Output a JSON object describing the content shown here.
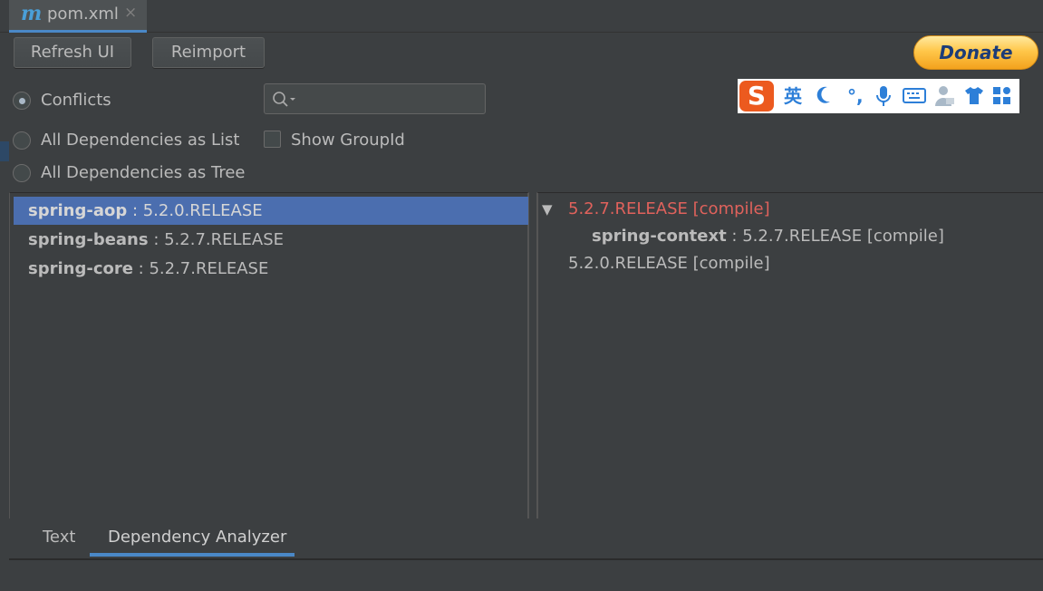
{
  "editor_tab": {
    "label": "pom.xml",
    "icon": "m",
    "close": "×"
  },
  "toolbar": {
    "refresh_label": "Refresh UI",
    "reimport_label": "Reimport"
  },
  "donate": {
    "label": "Donate"
  },
  "ime_toolbar": {
    "logo": "S",
    "mode": "英",
    "icons": [
      "moon-icon",
      "punctuation-icon",
      "microphone-icon",
      "keyboard-icon",
      "user-icon",
      "shirt-icon",
      "grid-icon"
    ]
  },
  "view_options": {
    "conflicts": "Conflicts",
    "list": "All Dependencies as List",
    "tree": "All Dependencies as Tree",
    "selected": "Conflicts",
    "show_groupid": "Show GroupId",
    "show_groupid_checked": false
  },
  "search": {
    "placeholder": "",
    "value": ""
  },
  "dependencies": [
    {
      "name": "spring-aop",
      "version": " : 5.2.0.RELEASE",
      "selected": true
    },
    {
      "name": "spring-beans",
      "version": " : 5.2.7.RELEASE",
      "selected": false
    },
    {
      "name": "spring-core",
      "version": " : 5.2.7.RELEASE",
      "selected": false
    }
  ],
  "tree": {
    "node1": "5.2.7.RELEASE [compile]",
    "node1_child_name": "spring-context",
    "node1_child_version": " : 5.2.7.RELEASE [compile]",
    "node2": "5.2.0.RELEASE [compile]"
  },
  "bottom_tabs": [
    {
      "label": "Text"
    },
    {
      "label": "Dependency Analyzer",
      "active": true
    }
  ],
  "colors": {
    "conflict": "#e0625c",
    "accent": "#4a88c7",
    "selection": "#4b6eaf"
  }
}
